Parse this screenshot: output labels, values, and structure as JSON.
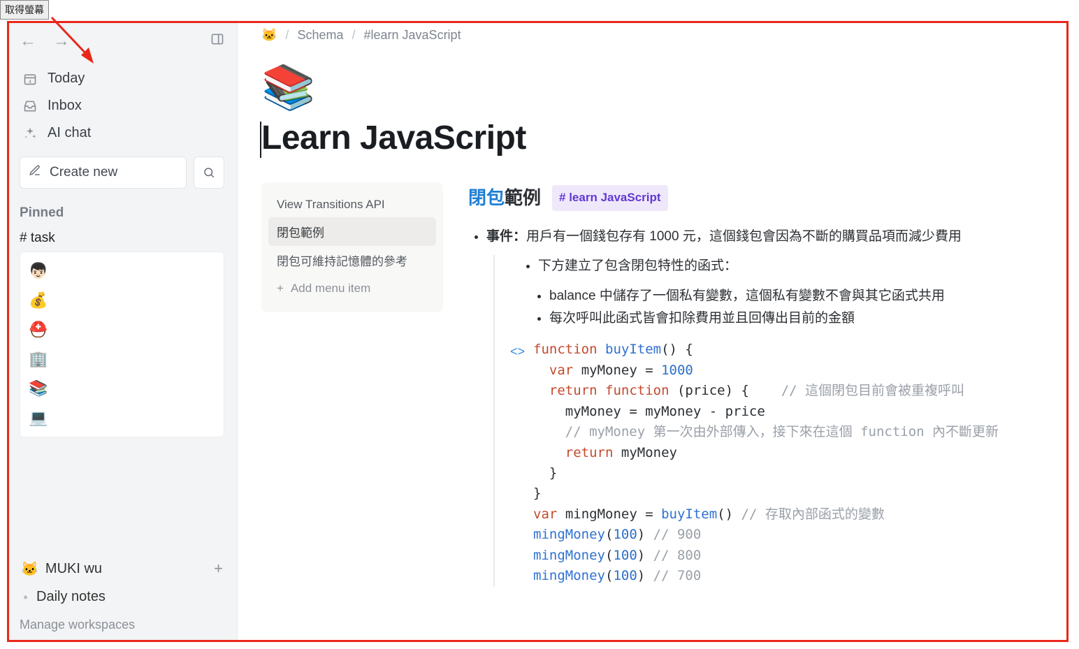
{
  "topButton": "取得螢幕",
  "sidebar": {
    "nav": [
      {
        "icon": "📅",
        "label": "Today"
      },
      {
        "icon": "inbox",
        "label": "Inbox"
      },
      {
        "icon": "sparkle",
        "label": "AI chat"
      }
    ],
    "createLabel": "Create new",
    "pinnedLabel": "Pinned",
    "taskTag": "# task",
    "pinnedItems": [
      "👦🏻",
      "💰",
      "⛑️",
      "🏢",
      "📚",
      "💻"
    ],
    "workspace": {
      "icon": "🐱",
      "name": "MUKI wu"
    },
    "daily": "Daily notes",
    "manage": "Manage workspaces"
  },
  "breadcrumb": {
    "icon": "🐱",
    "items": [
      "Schema",
      "#learn JavaScript"
    ]
  },
  "page": {
    "icon": "📚",
    "title": "Learn JavaScript"
  },
  "outline": {
    "items": [
      {
        "label": "View Transitions API",
        "active": false
      },
      {
        "label": "閉包範例",
        "active": true
      },
      {
        "label": "閉包可維持記憶體的參考",
        "active": false
      }
    ],
    "addLabel": "Add menu item"
  },
  "section": {
    "headingLink": "閉包",
    "headingRest": "範例",
    "tag": "# learn JavaScript",
    "bullet1Label": "事件：",
    "bullet1Text": "用戶有一個錢包存有 1000 元，這個錢包會因為不斷的購買品項而減少費用",
    "sub1": "下方建立了包含閉包特性的函式：",
    "subsub1": "balance 中儲存了一個私有變數，這個私有變數不會與其它函式共用",
    "subsub2": "每次呼叫此函式皆會扣除費用並且回傳出目前的金額",
    "code": {
      "fnKw": "function",
      "fnName": "buyItem",
      "varKw": "var",
      "myMoney": "myMoney",
      "thousand": "1000",
      "returnKw": "return",
      "price": "price",
      "comment1": "// 這個閉包目前會被重複呼叫",
      "comment2": "// myMoney 第一次由外部傳入，接下來在這個 function 內不斷更新",
      "mingMoney": "mingMoney",
      "commentStore": "// 存取內部函式的變數",
      "hundred": "100",
      "c900": "// 900",
      "c800": "// 800",
      "c700": "// 700"
    }
  }
}
